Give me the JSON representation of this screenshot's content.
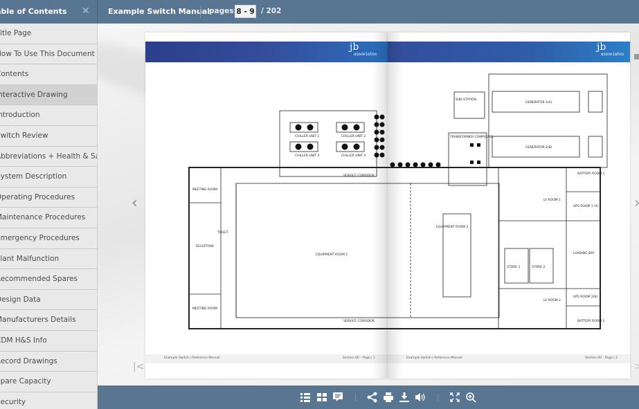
{
  "topbar": {
    "toc_title": "Table of Contents",
    "doc_title": "Example Switch Manual",
    "pages_label": "pages:",
    "pages_value": "8 - 9",
    "pages_total": "/ 202"
  },
  "sidebar": {
    "items": [
      {
        "label": "Title Page",
        "active": false
      },
      {
        "label": "How To Use This Document",
        "active": false
      },
      {
        "label": "Contents",
        "active": false
      },
      {
        "label": "Interactive Drawing",
        "active": true
      },
      {
        "label": "Introduction",
        "active": false
      },
      {
        "label": "Switch Review",
        "active": false
      },
      {
        "label": "Abbreviations + Health & Safety",
        "active": false
      },
      {
        "label": "System Description",
        "active": false
      },
      {
        "label": "Operating Procedures",
        "active": false
      },
      {
        "label": "Maintenance Procedures",
        "active": false
      },
      {
        "label": "Emergency Procedures",
        "active": false
      },
      {
        "label": "Plant Malfunction",
        "active": false
      },
      {
        "label": "Recommended Spares",
        "active": false
      },
      {
        "label": "Design Data",
        "active": false
      },
      {
        "label": "Manufacturers Details",
        "active": false
      },
      {
        "label": "CDM H&S Info",
        "active": false
      },
      {
        "label": "Record Drawings",
        "active": false
      },
      {
        "label": "Spare Capacity",
        "active": false
      },
      {
        "label": "Security",
        "active": false
      }
    ]
  },
  "pages": {
    "logo_main": "jb",
    "logo_sub": "associates",
    "left_footer_left": "Example Switch | Reference Manual",
    "left_footer_right": "Section 00 – Page | 1",
    "right_footer_left": "Example Switch | Reference Manual",
    "right_footer_right": "Section 00 – Page | 2"
  },
  "drawing": {
    "labels": {
      "service_corridor": "SERVICE CORRIDOR",
      "equipment_room_1": "EQUIPMENT ROOM 1",
      "equipment_room_2": "EQUIPMENT ROOM 2",
      "meeting_room": "MEETING ROOM",
      "reception": "RECEPTION",
      "toilet": "TOILET",
      "sub_station": "SUB-STATION",
      "transformer_compound": "TRANSFORMER COMPOUND",
      "generator_1": "GENERATOR 1(A)",
      "generator_2": "GENERATOR 2(B)",
      "lv_room_1": "LV ROOM 1",
      "lv_room_2": "LV ROOM 2",
      "ups_room_1": "UPS ROOM 1 (A)",
      "ups_room_2": "UPS ROOM 2(B)",
      "battery_room_1": "BATTERY ROOM 1",
      "battery_room_2": "BATTERY ROOM 2",
      "loading_bay": "LOADING BAY",
      "store_1": "STORE 1",
      "store_2": "STORE 2",
      "chiller_1": "CHILLER UNIT 1",
      "chiller_2": "CHILLER UNIT 2",
      "chiller_3": "CHILLER UNIT 3",
      "chiller_4": "CHILLER UNIT 4"
    }
  },
  "toolbar": {
    "icons": [
      "list-icon",
      "grid-icon",
      "comment-icon",
      "share-icon",
      "print-icon",
      "download-icon",
      "sound-icon",
      "fullscreen-icon",
      "zoom-in-icon"
    ]
  },
  "colors": {
    "chrome": "#587592",
    "band": "#344d9b",
    "sidebar_bg": "#e9e9ea",
    "sidebar_active": "#d2d2d4"
  }
}
